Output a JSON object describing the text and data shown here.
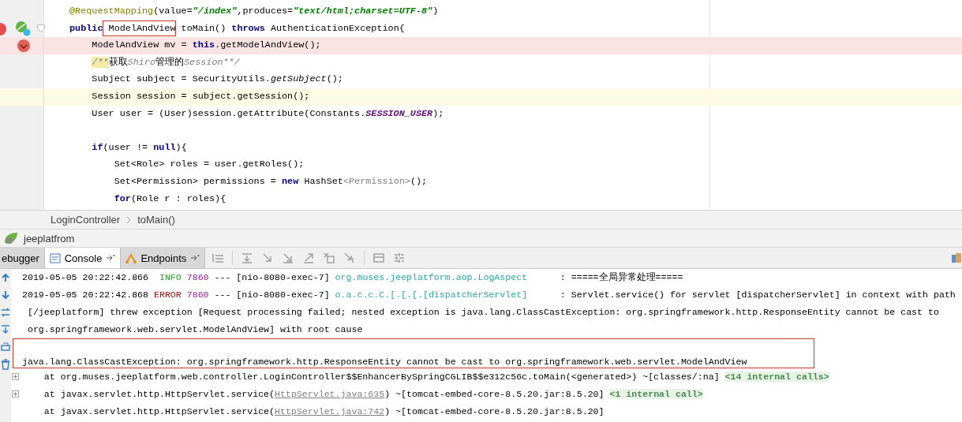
{
  "editor": {
    "lines": [
      {
        "kind": "statement",
        "segments": [
          {
            "text": "@RequestMapping",
            "kind": "annotation"
          },
          {
            "text": "(value=",
            "kind": "plain"
          },
          {
            "text": "\"/index\"",
            "kind": "string"
          },
          {
            "text": ",produces=",
            "kind": "plain"
          },
          {
            "text": "\"text/html;charset=UTF-8\"",
            "kind": "string"
          },
          {
            "text": ")",
            "kind": "plain"
          }
        ]
      },
      {
        "kind": "method",
        "segments": [
          {
            "text": "public",
            "kind": "keyword"
          },
          {
            "text": " ModelAndView",
            "kind": "plain",
            "boxed": true
          },
          {
            "text": " toMain() ",
            "kind": "plain"
          },
          {
            "text": "throws",
            "kind": "keyword"
          },
          {
            "text": " AuthenticationException{",
            "kind": "plain"
          }
        ]
      },
      {
        "kind": "statement",
        "breakpoint": true,
        "segments": [
          {
            "text": "    ModelAndView mv = ",
            "kind": "plain"
          },
          {
            "text": "this",
            "kind": "keyword"
          },
          {
            "text": ".getModelAndView();",
            "kind": "plain"
          }
        ]
      },
      {
        "kind": "statement",
        "segments": [
          {
            "text": "    /**",
            "kind": "marker"
          },
          {
            "text": "获取",
            "kind": "plain"
          },
          {
            "text": "Shiro",
            "kind": "comment"
          },
          {
            "text": "管理的",
            "kind": "plain"
          },
          {
            "text": "Session**/",
            "kind": "comment"
          }
        ]
      },
      {
        "kind": "statement",
        "segments": [
          {
            "text": "    Subject subject = SecurityUtils.",
            "kind": "plain"
          },
          {
            "text": "getSubject",
            "kind": "italic"
          },
          {
            "text": "();",
            "kind": "plain"
          }
        ]
      },
      {
        "kind": "statement",
        "current": true,
        "segments": [
          {
            "text": "    Session session = subject.getSession();",
            "kind": "plain"
          }
        ]
      },
      {
        "kind": "statement",
        "segments": [
          {
            "text": "    User user = (User)session.getAttribute(Constants.",
            "kind": "plain"
          },
          {
            "text": "SESSION_USER",
            "kind": "constant"
          },
          {
            "text": ");",
            "kind": "plain"
          }
        ]
      },
      {
        "kind": "blank"
      },
      {
        "kind": "statement",
        "segments": [
          {
            "text": "    if",
            "kind": "keyword"
          },
          {
            "text": "(user != ",
            "kind": "plain"
          },
          {
            "text": "null",
            "kind": "keyword"
          },
          {
            "text": "){",
            "kind": "plain"
          }
        ]
      },
      {
        "kind": "statement",
        "segments": [
          {
            "text": "        Set<Role> roles = user.getRoles();",
            "kind": "plain"
          }
        ]
      },
      {
        "kind": "statement",
        "segments": [
          {
            "text": "        Set<Permission> permissions = ",
            "kind": "plain"
          },
          {
            "text": "new",
            "kind": "keyword"
          },
          {
            "text": " HashSet",
            "kind": "plain"
          },
          {
            "text": "<Permission>",
            "kind": "generic"
          },
          {
            "text": "();",
            "kind": "plain"
          }
        ]
      },
      {
        "kind": "statement",
        "segments": [
          {
            "text": "        for",
            "kind": "keyword"
          },
          {
            "text": "(Role r : roles){",
            "kind": "plain"
          }
        ]
      }
    ]
  },
  "breadcrumbs": [
    "LoginController",
    "toMain()"
  ],
  "run_config": {
    "name": "jeeplatfrom"
  },
  "tool_tabs": [
    {
      "label": "ebugger",
      "selected": false,
      "kind": "debugger"
    },
    {
      "label": "Console",
      "selected": true,
      "kind": "console"
    },
    {
      "label": "Endpoints",
      "selected": false,
      "kind": "endpoints"
    }
  ],
  "console": {
    "lines": [
      {
        "segments": [
          {
            "text": "2019-05-05 20:22:42.866  ",
            "kind": "plain"
          },
          {
            "text": "INFO ",
            "kind": "info"
          },
          {
            "text": "7860",
            "kind": "pid"
          },
          {
            "text": " --- [nio-8080-exec-7] ",
            "kind": "plain"
          },
          {
            "text": "org.muses.jeeplatform.aop.LogAspect",
            "kind": "logger"
          },
          {
            "text": "      : =====全局异常处理=====",
            "kind": "plain"
          }
        ]
      },
      {
        "segments": [
          {
            "text": "2019-05-05 20:22:42.868 ",
            "kind": "plain"
          },
          {
            "text": "ERROR ",
            "kind": "error"
          },
          {
            "text": "7860",
            "kind": "pid"
          },
          {
            "text": " --- [nio-8080-exec-7] ",
            "kind": "plain"
          },
          {
            "text": "o.a.c.c.C.[.[.[.[dispatcherServlet]",
            "kind": "logger"
          },
          {
            "text": "      : Servlet.service() for servlet [dispatcherServlet] in context with path",
            "kind": "plain"
          }
        ]
      },
      {
        "segments": [
          {
            "text": " [/jeeplatform] threw exception [Request processing failed; nested exception is java.lang.ClassCastException: org.springframework.http.ResponseEntity cannot be cast to",
            "kind": "plain"
          }
        ]
      },
      {
        "segments": [
          {
            "text": " org.springframework.web.servlet.ModelAndView] with root cause",
            "kind": "plain"
          }
        ]
      },
      {
        "boxed": true,
        "segments": [
          {
            "text": "java.lang.ClassCastException: org.springframework.http.ResponseEntity cannot be cast to org.springframework.web.servlet.ModelAndView",
            "kind": "plain"
          }
        ]
      },
      {
        "expanded": false,
        "segments": [
          {
            "text": "    at org.muses.jeeplatform.web.controller.LoginController$$EnhancerBySpringCGLIB$$e312c56c.toMain(<generated>) ~[classes/:na] ",
            "kind": "plain"
          },
          {
            "text": "<14 internal calls>",
            "kind": "fold"
          }
        ]
      },
      {
        "expanded": false,
        "segments": [
          {
            "text": "    at javax.servlet.http.HttpServlet.service(",
            "kind": "plain"
          },
          {
            "text": "HttpServlet.java:635",
            "kind": "link"
          },
          {
            "text": ") ~[tomcat-embed-core-8.5.20.jar:8.5.20] ",
            "kind": "plain"
          },
          {
            "text": "<1 internal call>",
            "kind": "fold"
          }
        ]
      },
      {
        "segments": [
          {
            "text": "    at javax.servlet.http.HttpServlet.service(",
            "kind": "plain"
          },
          {
            "text": "HttpServlet.java:742",
            "kind": "link"
          },
          {
            "text": ") ~[tomcat-embed-core-8.5.20.jar:8.5.20]",
            "kind": "plain"
          }
        ]
      }
    ]
  }
}
